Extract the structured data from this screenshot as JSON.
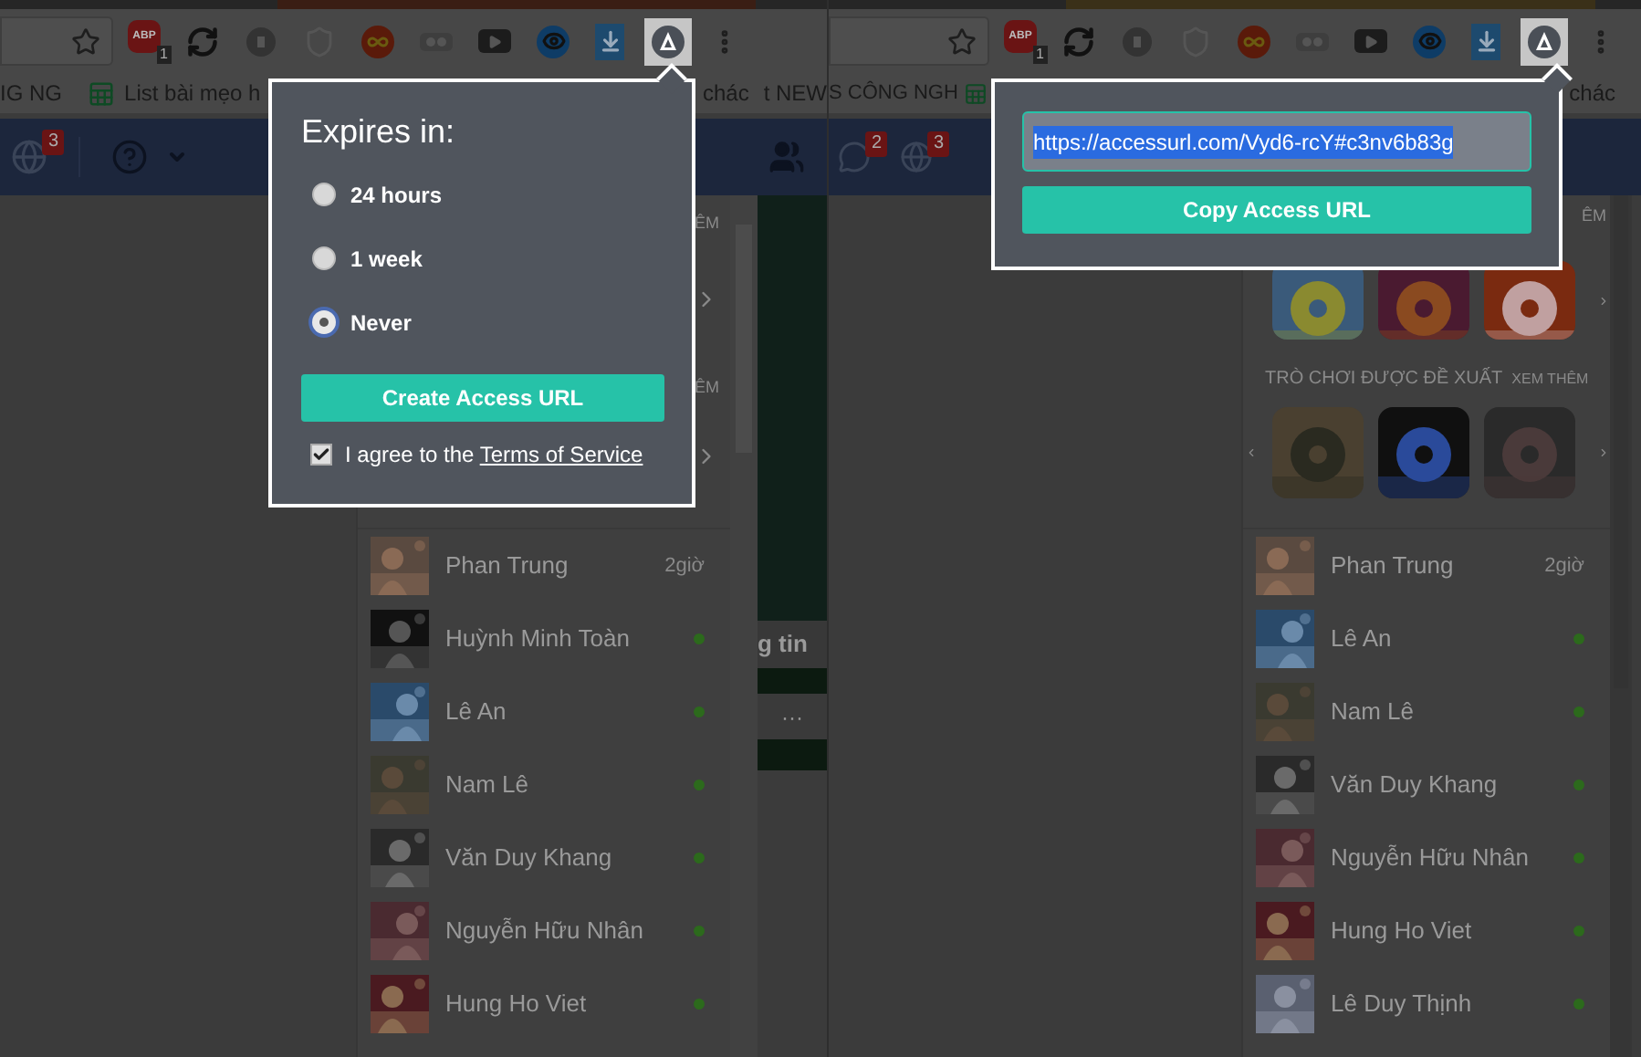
{
  "left_window": {
    "abp_label": "ABP",
    "abp_count": "1",
    "bookmarks": [
      {
        "label": "IG NG",
        "sheet": false
      },
      {
        "label": "List bài mẹo h",
        "sheet": true
      }
    ],
    "bookmarks_right": [
      "chác",
      "t NEW"
    ],
    "notifications": "3",
    "section_tails": [
      "ÊM",
      "ÊM"
    ],
    "post_button": "g tin",
    "post_more": "···",
    "friends": [
      {
        "name": "Phan Trung",
        "online": false,
        "last_active": "2giờ"
      },
      {
        "name": "Huỳnh Minh Toàn",
        "online": true
      },
      {
        "name": "Lê An",
        "online": true
      },
      {
        "name": "Nam Lê",
        "online": true
      },
      {
        "name": "Văn Duy Khang",
        "online": true
      },
      {
        "name": "Nguyễn Hữu Nhân",
        "online": true
      },
      {
        "name": "Hung Ho Viet",
        "online": true
      }
    ]
  },
  "right_window": {
    "abp_label": "ABP",
    "abp_count": "1",
    "bookmarks": [
      {
        "label": "S CÔNG NGH",
        "sheet": false
      }
    ],
    "bookmarks_right": [
      "chác"
    ],
    "messages": "2",
    "notifications": "3",
    "section_tail": "ÊM",
    "games_title": "TRÒ CHƠI ĐƯỢC ĐỀ XUẤT",
    "games_more": "XEM THÊM",
    "friends": [
      {
        "name": "Phan Trung",
        "online": false,
        "last_active": "2giờ"
      },
      {
        "name": "Lê An",
        "online": true
      },
      {
        "name": "Nam Lê",
        "online": true
      },
      {
        "name": "Văn Duy Khang",
        "online": true
      },
      {
        "name": "Nguyễn Hữu Nhân",
        "online": true
      },
      {
        "name": "Hung Ho Viet",
        "online": true
      },
      {
        "name": "Lê Duy Thịnh",
        "online": true
      }
    ]
  },
  "expiry_popup": {
    "title": "Expires in:",
    "options": [
      {
        "label": "24 hours",
        "selected": false
      },
      {
        "label": "1 week",
        "selected": false
      },
      {
        "label": "Never",
        "selected": true
      }
    ],
    "button": "Create Access URL",
    "agree": {
      "checked": true,
      "text": "I agree to the ",
      "link": "Terms of Service"
    }
  },
  "url_popup": {
    "url": "https://accessurl.com/Vyd6-rcY#c3nv6b83g",
    "url_selected": true,
    "button": "Copy Access URL"
  }
}
